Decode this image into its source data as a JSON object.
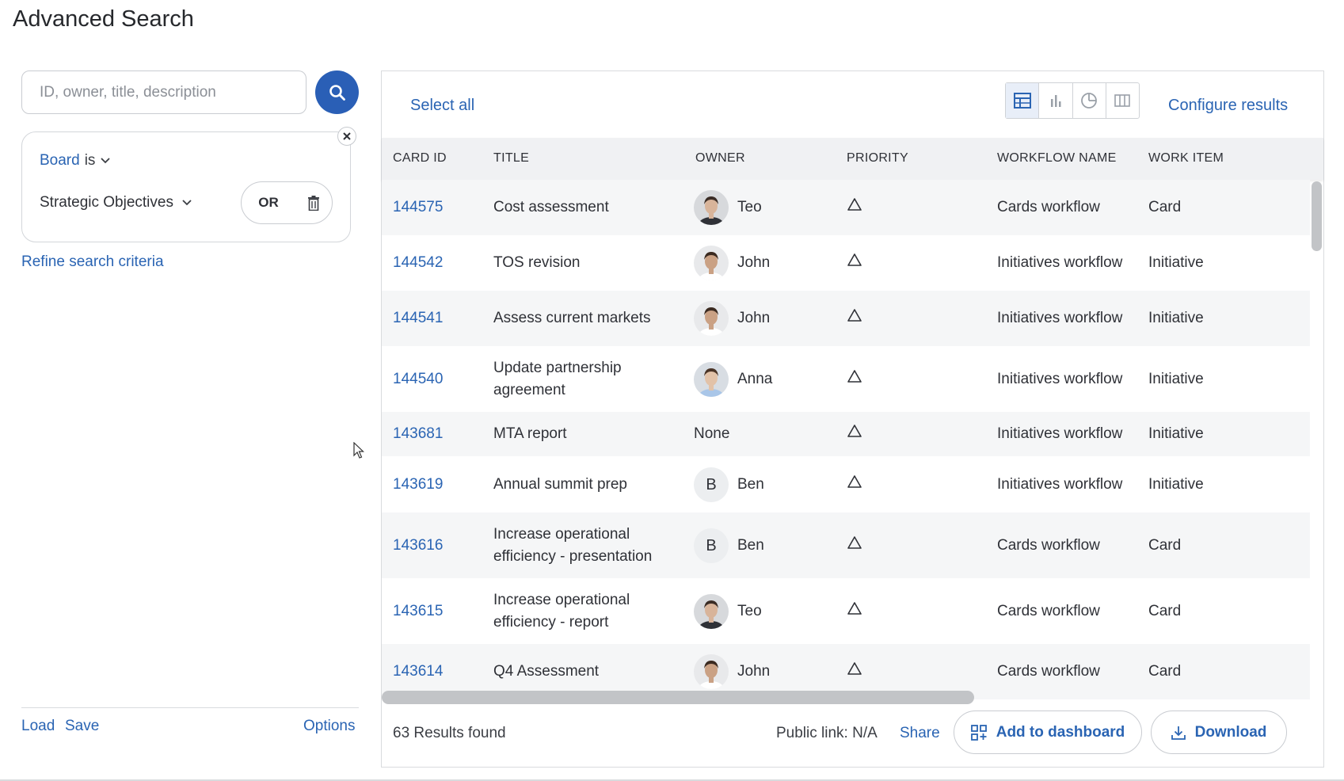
{
  "page": {
    "title": "Advanced Search"
  },
  "search": {
    "placeholder": "ID, owner, title, description",
    "value": ""
  },
  "filter": {
    "field": "Board",
    "operator": "is",
    "value": "Strategic Objectives",
    "logic": "OR"
  },
  "left": {
    "refine_label": "Refine search criteria",
    "load_label": "Load",
    "save_label": "Save",
    "options_label": "Options"
  },
  "results": {
    "select_all_label": "Select all",
    "configure_label": "Configure results",
    "view_modes": [
      "table-view",
      "bar-chart-view",
      "pie-chart-view",
      "board-view"
    ],
    "active_view": "table-view",
    "columns": [
      "CARD ID",
      "TITLE",
      "OWNER",
      "PRIORITY",
      "WORKFLOW NAME",
      "WORK ITEM"
    ],
    "rows": [
      {
        "id": "144575",
        "title": "Cost assessment",
        "owner": "Teo",
        "avatar": "photo-teo",
        "priority": "triangle-icon",
        "workflow": "Cards workflow",
        "item": "Card"
      },
      {
        "id": "144542",
        "title": "TOS revision",
        "owner": "John",
        "avatar": "photo-john",
        "priority": "triangle-icon",
        "workflow": "Initiatives workflow",
        "item": "Initiative"
      },
      {
        "id": "144541",
        "title": "Assess current markets",
        "owner": "John",
        "avatar": "photo-john",
        "priority": "triangle-icon",
        "workflow": "Initiatives workflow",
        "item": "Initiative"
      },
      {
        "id": "144540",
        "title": "Update partnership agreement",
        "owner": "Anna",
        "avatar": "photo-anna",
        "priority": "triangle-icon",
        "workflow": "Initiatives workflow",
        "item": "Initiative"
      },
      {
        "id": "143681",
        "title": "MTA report",
        "owner": "None",
        "avatar": "",
        "priority": "triangle-icon",
        "workflow": "Initiatives workflow",
        "item": "Initiative"
      },
      {
        "id": "143619",
        "title": "Annual summit prep",
        "owner": "Ben",
        "avatar": "letter",
        "avatar_letter": "B",
        "priority": "triangle-icon",
        "workflow": "Initiatives workflow",
        "item": "Initiative"
      },
      {
        "id": "143616",
        "title": "Increase operational efficiency - presentation",
        "owner": "Ben",
        "avatar": "letter",
        "avatar_letter": "B",
        "priority": "triangle-icon",
        "workflow": "Cards workflow",
        "item": "Card"
      },
      {
        "id": "143615",
        "title": "Increase operational efficiency - report",
        "owner": "Teo",
        "avatar": "photo-teo",
        "priority": "triangle-icon",
        "workflow": "Cards workflow",
        "item": "Card"
      },
      {
        "id": "143614",
        "title": "Q4 Assessment",
        "owner": "John",
        "avatar": "photo-john",
        "priority": "triangle-icon",
        "workflow": "Cards workflow",
        "item": "Card"
      }
    ],
    "count_label": "63 Results found",
    "public_link_label": "Public link: N/A",
    "share_label": "Share",
    "add_dashboard_label": "Add to dashboard",
    "download_label": "Download"
  },
  "colors": {
    "accent": "#2a64b3",
    "search_button": "#2a5fb6",
    "header_bg": "#f0f1f3",
    "row_alt": "#f5f6f7"
  }
}
